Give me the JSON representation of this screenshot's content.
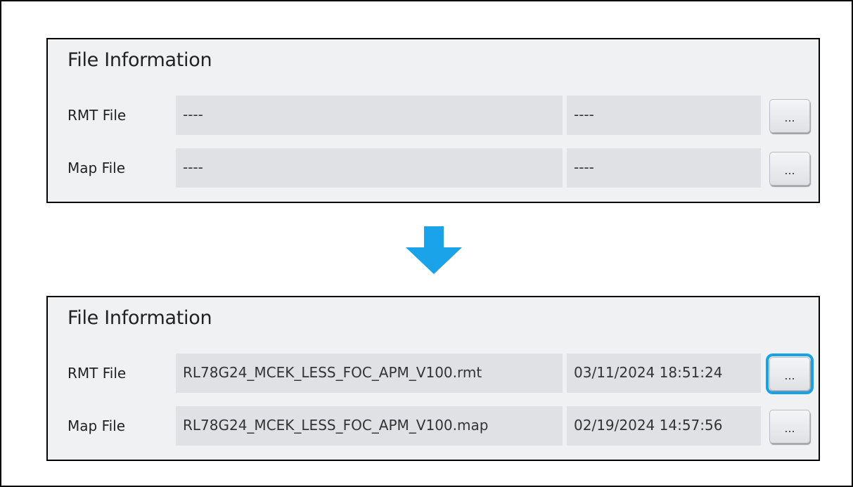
{
  "before_panel": {
    "title": "File Information",
    "rows": [
      {
        "label": "RMT File",
        "file_name": "----",
        "file_date": "----",
        "browse_label": "..."
      },
      {
        "label": "Map File",
        "file_name": "----",
        "file_date": "----",
        "browse_label": "..."
      }
    ]
  },
  "after_panel": {
    "title": "File Information",
    "rows": [
      {
        "label": "RMT File",
        "file_name": "RL78G24_MCEK_LESS_FOC_APM_V100.rmt",
        "file_date": "03/11/2024 18:51:24",
        "browse_label": "..."
      },
      {
        "label": "Map File",
        "file_name": "RL78G24_MCEK_LESS_FOC_APM_V100.map",
        "file_date": "02/19/2024 14:57:56",
        "browse_label": "..."
      }
    ]
  },
  "colors": {
    "panel_background": "#f0f1f3",
    "field_background": "#e0e1e4",
    "arrow": "#1aa3e8",
    "focus_highlight": "#17a2e8"
  },
  "icons": {
    "transition_arrow": "arrow-down-icon"
  }
}
